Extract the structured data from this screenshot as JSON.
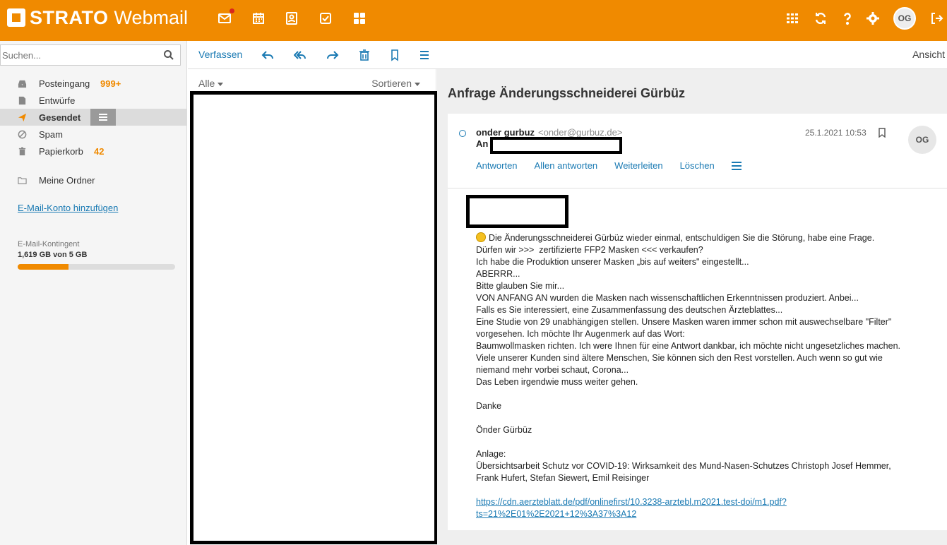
{
  "app": {
    "brand": "STRATO",
    "product": "Webmail"
  },
  "topbar": {
    "left_icons": [
      "mail-icon",
      "calendar-icon",
      "contacts-icon",
      "tasks-icon",
      "apps-icon"
    ],
    "right_icons": [
      "grid-icon",
      "refresh-icon",
      "help-icon",
      "settings-icon",
      "logout-icon"
    ],
    "user_initials": "OG"
  },
  "search": {
    "placeholder": "Suchen..."
  },
  "folders": [
    {
      "label": "Posteingang",
      "count": "999+",
      "icon": "inbox-icon"
    },
    {
      "label": "Entwürfe",
      "count": "",
      "icon": "draft-icon"
    },
    {
      "label": "Gesendet",
      "count": "",
      "icon": "sent-icon",
      "active": true
    },
    {
      "label": "Spam",
      "count": "",
      "icon": "spam-icon"
    },
    {
      "label": "Papierkorb",
      "count": "42",
      "icon": "trash-icon"
    }
  ],
  "my_folders_label": "Meine Ordner",
  "add_account_label": "E-Mail-Konto hinzufügen",
  "quota": {
    "label": "E-Mail-Kontingent",
    "value": "1,619 GB von 5 GB",
    "fraction": 0.3238
  },
  "toolbar": {
    "compose_label": "Verfassen",
    "view_label": "Ansicht"
  },
  "list": {
    "filter_label": "Alle",
    "sort_label": "Sortieren"
  },
  "message": {
    "subject": "Anfrage Änderungsschneiderei Gürbüz",
    "from_name": "onder gurbuz",
    "from_email": "<onder@gurbuz.de>",
    "to_label": "An",
    "date": "25.1.2021 10:53",
    "sender_initials": "OG",
    "actions": [
      "Antworten",
      "Allen antworten",
      "Weiterleiten",
      "Löschen"
    ],
    "body_lines": [
      "Die Änderungsschneiderei Gürbüz wieder einmal, entschuldigen Sie die Störung, habe eine Frage.",
      "Dürfen wir >>>  zertifizierte FFP2 Masken <<< verkaufen?",
      "Ich habe die Produktion unserer Masken „bis auf weiters\" eingestellt...",
      "ABERRR...",
      "Bitte glauben Sie mir...",
      "VON ANFANG AN wurden die Masken nach wissenschaftlichen Erkenntnissen produziert. Anbei...",
      "Falls es Sie interessiert, eine Zusammenfassung des deutschen Ärzteblattes...",
      "Eine Studie von 29 unabhängigen stellen. Unsere Masken waren immer schon mit auswechselbare \"Filter\"",
      "vorgesehen. Ich möchte Ihr Augenmerk auf das Wort:",
      "Baumwollmasken richten. Ich were Ihnen für eine Antwort dankbar, ich möchte nicht ungesetzliches machen.",
      "Viele unserer Kunden sind ältere Menschen, Sie können sich den Rest vorstellen. Auch wenn so gut wie",
      "niemand mehr vorbei schaut, Corona...",
      "Das Leben irgendwie muss weiter gehen."
    ],
    "thanks": "Danke",
    "signature": "Önder Gürbüz",
    "attachment_label": "Anlage:",
    "attachment_line1": "Übersichtsarbeit Schutz vor COVID-19: Wirksamkeit des Mund-Nasen-Schutzes Christoph Josef Hemmer,",
    "attachment_line2": "Frank Hufert, Stefan Siewert, Emil Reisinger",
    "link_line1": "https://cdn.aerzteblatt.de/pdf/onlinefirst/10.3238-arztebl.m2021.test-doi/m1.pdf?",
    "link_line2": "ts=21%2E01%2E2021+12%3A37%3A12"
  }
}
